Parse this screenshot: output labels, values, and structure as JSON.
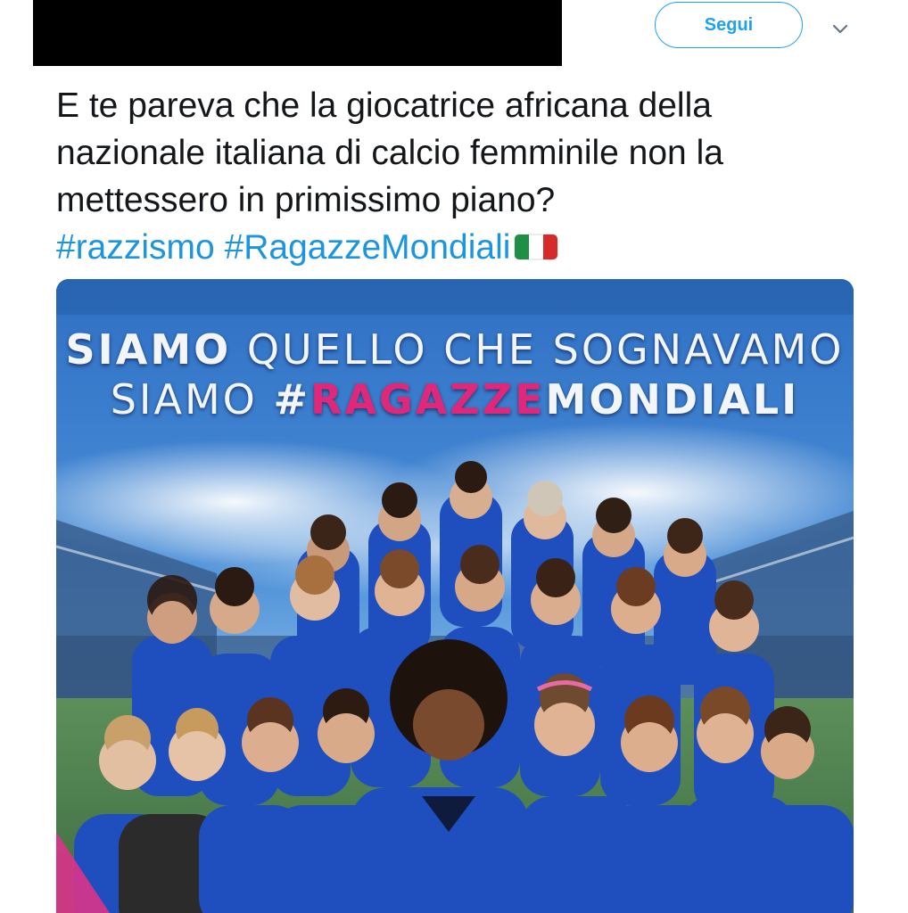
{
  "header": {
    "follow_label": "Segui"
  },
  "tweet": {
    "lines": [
      "E te pareva che la giocatrice africana della",
      "nazionale italiana di calcio femminile non la",
      "mettessero in primissimo piano?"
    ],
    "hashtags": [
      "#razzismo",
      "#RagazzeMondiali"
    ]
  },
  "media": {
    "headline_line1_bold": "SIAMO",
    "headline_line1_rest": " QUELLO CHE SOGNAVAMO",
    "headline_line2_start": "SIAMO ",
    "headline_line2_hash": "#",
    "headline_line2_pink": "RAGAZZE",
    "headline_line2_end": "MONDIALI"
  },
  "colors": {
    "link": "#1b95e0",
    "follow_border": "#1da1f2",
    "headline_pink": "#e0287a",
    "jersey_blue": "#1f4fbf"
  },
  "icons": {
    "caret": "chevron-down-icon",
    "flag": "italy-flag-emoji"
  }
}
